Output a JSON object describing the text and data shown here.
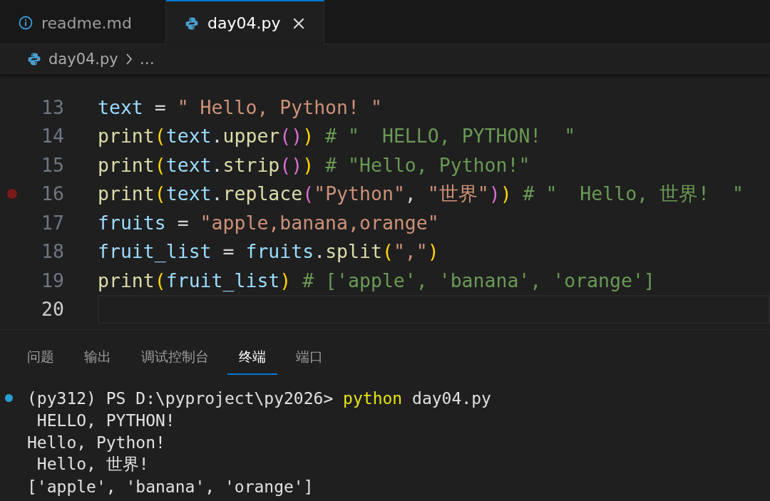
{
  "tabs": [
    {
      "label": "readme.md",
      "kind": "markdown",
      "selected": false
    },
    {
      "label": "day04.py",
      "kind": "python",
      "selected": true
    }
  ],
  "breadcrumb": {
    "file": "day04.py",
    "kind": "python",
    "more": "…"
  },
  "editor": {
    "lines": [
      {
        "number": "13",
        "current": false,
        "breakpoint": false,
        "tokens": [
          {
            "kind": "var",
            "text": "text"
          },
          {
            "kind": "op",
            "text": " = "
          },
          {
            "kind": "str",
            "text": "\" Hello, Python! \""
          }
        ]
      },
      {
        "number": "14",
        "current": false,
        "breakpoint": false,
        "tokens": [
          {
            "kind": "fn",
            "text": "print"
          },
          {
            "kind": "b1",
            "text": "("
          },
          {
            "kind": "var",
            "text": "text"
          },
          {
            "kind": "op",
            "text": "."
          },
          {
            "kind": "fn",
            "text": "upper"
          },
          {
            "kind": "b2",
            "text": "()"
          },
          {
            "kind": "b1",
            "text": ")"
          },
          {
            "kind": "cmt",
            "text": " # \"  HELLO, PYTHON!  \""
          }
        ]
      },
      {
        "number": "15",
        "current": false,
        "breakpoint": false,
        "tokens": [
          {
            "kind": "fn",
            "text": "print"
          },
          {
            "kind": "b1",
            "text": "("
          },
          {
            "kind": "var",
            "text": "text"
          },
          {
            "kind": "op",
            "text": "."
          },
          {
            "kind": "fn",
            "text": "strip"
          },
          {
            "kind": "b2",
            "text": "()"
          },
          {
            "kind": "b1",
            "text": ")"
          },
          {
            "kind": "cmt",
            "text": " # \"Hello, Python!\""
          }
        ]
      },
      {
        "number": "16",
        "current": false,
        "breakpoint": true,
        "tokens": [
          {
            "kind": "fn",
            "text": "print"
          },
          {
            "kind": "b1",
            "text": "("
          },
          {
            "kind": "var",
            "text": "text"
          },
          {
            "kind": "op",
            "text": "."
          },
          {
            "kind": "fn",
            "text": "replace"
          },
          {
            "kind": "b2",
            "text": "("
          },
          {
            "kind": "str",
            "text": "\"Python\""
          },
          {
            "kind": "op",
            "text": ", "
          },
          {
            "kind": "str",
            "text": "\"世界\""
          },
          {
            "kind": "b2",
            "text": ")"
          },
          {
            "kind": "b1",
            "text": ")"
          },
          {
            "kind": "cmt",
            "text": " # \"  Hello, 世界!  \""
          }
        ]
      },
      {
        "number": "17",
        "current": false,
        "breakpoint": false,
        "tokens": [
          {
            "kind": "var",
            "text": "fruits"
          },
          {
            "kind": "op",
            "text": " = "
          },
          {
            "kind": "str",
            "text": "\"apple,banana,orange\""
          }
        ]
      },
      {
        "number": "18",
        "current": false,
        "breakpoint": false,
        "tokens": [
          {
            "kind": "var",
            "text": "fruit_list"
          },
          {
            "kind": "op",
            "text": " = "
          },
          {
            "kind": "var",
            "text": "fruits"
          },
          {
            "kind": "op",
            "text": "."
          },
          {
            "kind": "fn",
            "text": "split"
          },
          {
            "kind": "b1",
            "text": "("
          },
          {
            "kind": "str",
            "text": "\",\""
          },
          {
            "kind": "b1",
            "text": ")"
          }
        ]
      },
      {
        "number": "19",
        "current": false,
        "breakpoint": false,
        "tokens": [
          {
            "kind": "fn",
            "text": "print"
          },
          {
            "kind": "b1",
            "text": "("
          },
          {
            "kind": "var",
            "text": "fruit_list"
          },
          {
            "kind": "b1",
            "text": ")"
          },
          {
            "kind": "cmt",
            "text": " # ['apple', 'banana', 'orange']"
          }
        ]
      },
      {
        "number": "20",
        "current": true,
        "breakpoint": false
      }
    ]
  },
  "panel": {
    "tabs": [
      {
        "label": "问题",
        "selected": false
      },
      {
        "label": "输出",
        "selected": false
      },
      {
        "label": "调试控制台",
        "selected": false
      },
      {
        "label": "终端",
        "selected": true
      },
      {
        "label": "端口",
        "selected": false
      }
    ],
    "terminal": [
      {
        "kind": "command",
        "segments": [
          {
            "kind": "prompt",
            "text": "(py312) PS D:\\pyproject\\py2026> "
          },
          {
            "kind": "cmd",
            "text": "python"
          },
          {
            "kind": "arg",
            "text": " day04.py"
          }
        ]
      },
      {
        "kind": "output",
        "segments": [
          {
            "kind": "out",
            "text": " HELLO, PYTHON!"
          }
        ]
      },
      {
        "kind": "output",
        "segments": [
          {
            "kind": "out",
            "text": "Hello, Python!"
          }
        ]
      },
      {
        "kind": "output",
        "segments": [
          {
            "kind": "out",
            "text": " Hello, 世界!"
          }
        ]
      },
      {
        "kind": "output",
        "segments": [
          {
            "kind": "out",
            "text": "['apple', 'banana', 'orange']"
          }
        ]
      }
    ]
  }
}
